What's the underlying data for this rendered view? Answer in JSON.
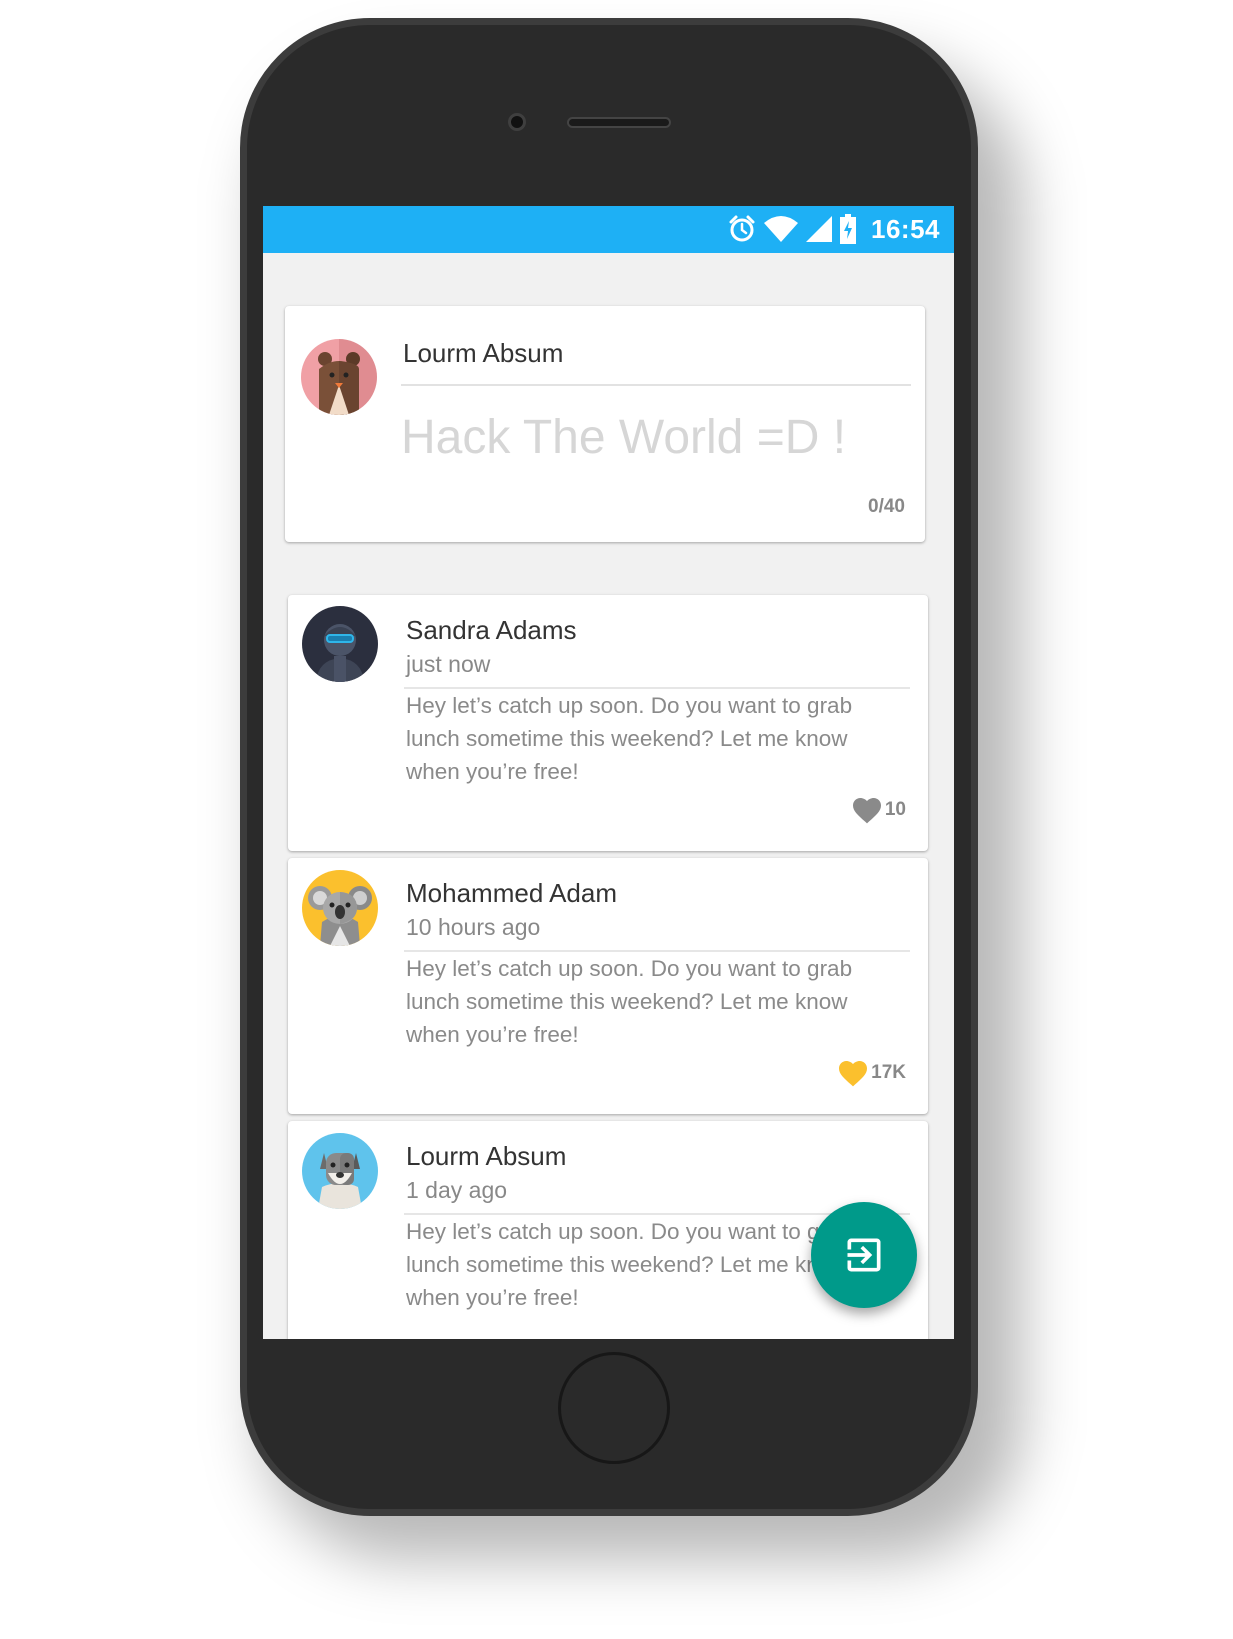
{
  "status_bar": {
    "time": "16:54",
    "icons": [
      "alarm-icon",
      "wifi-icon",
      "signal-icon",
      "battery-charging-icon"
    ],
    "color": "#1eb0f5"
  },
  "compose": {
    "user_name": "Lourm Absum",
    "placeholder": "Hack The World =D !",
    "counter": "0/40",
    "avatar": "bear-avatar"
  },
  "posts": [
    {
      "name": "Sandra Adams",
      "time": "just now",
      "body": "Hey let’s catch up soon. Do you want to grab lunch sometime this weekend? Let me know when you’re free!",
      "likes": "10",
      "liked": false,
      "avatar": "soldier-avatar"
    },
    {
      "name": "Mohammed Adam",
      "time": "10 hours ago",
      "body": "Hey let’s catch up soon. Do you want to grab lunch sometime this weekend? Let me know when you’re free!",
      "likes": "17K",
      "liked": true,
      "avatar": "koala-avatar"
    },
    {
      "name": "Lourm Absum",
      "time": "1 day ago",
      "body": "Hey let’s catch up soon. Do you want to grab lunch sometime this weekend? Let me know when you’re free!",
      "avatar": "dog-avatar"
    }
  ],
  "fab": {
    "icon": "exit-to-app-icon",
    "color": "#009a8a"
  },
  "colors": {
    "heart_liked": "#fbc02d",
    "heart_default": "#8a8a8a"
  }
}
